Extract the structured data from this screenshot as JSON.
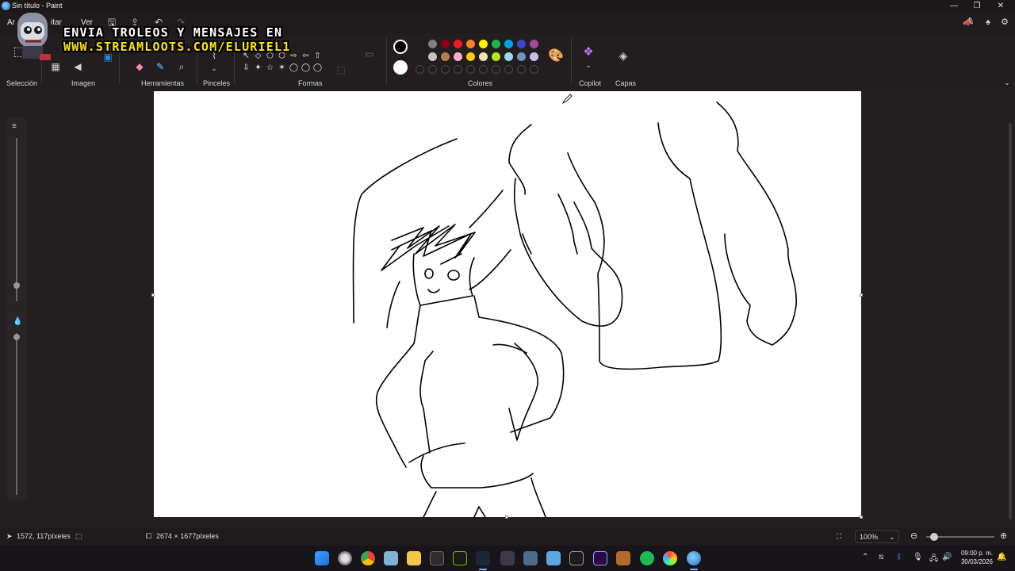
{
  "window": {
    "title": "Sin título - Paint",
    "minimize_glyph": "—",
    "restore_glyph": "❐",
    "close_glyph": "✕"
  },
  "menu": {
    "items": [
      "Archivo",
      "Editar",
      "Ver"
    ],
    "file_partial": "Ar",
    "edit_partial": "itar",
    "view": "Ver"
  },
  "ribbon": {
    "groups": {
      "selection": "Selección",
      "image": "Imagen",
      "tools": "Herramientas",
      "brushes": "Pinceles",
      "shapes": "Formas",
      "colors": "Colores",
      "copilot": "Copilot",
      "layers": "Capas"
    },
    "palette_row1": [
      "#000000",
      "#7f7f7f",
      "#880015",
      "#ed1c24",
      "#ff7f27",
      "#fff200",
      "#22b14c",
      "#00a2e8",
      "#3f48cc",
      "#a349a4"
    ],
    "palette_row2": [
      "#ffffff",
      "#c3c3c3",
      "#b97a57",
      "#ffaec9",
      "#ffc90e",
      "#efe4b0",
      "#b5e61d",
      "#99d9ea",
      "#7092be",
      "#c8bfe7"
    ],
    "primary_color": "#000000",
    "secondary_color": "#ffffff",
    "shapes": [
      "↖",
      "◇",
      "⬠",
      "⬡",
      "⇨",
      "⇦",
      "⇧",
      "⇩",
      "✦",
      "☆",
      "✶",
      "◯",
      "◯"
    ]
  },
  "overlay": {
    "line1": "ENVIA TROLEOS Y MENSAJES EN",
    "line2": "WWW.STREAMLOOTS.COM/ELURIEL1"
  },
  "status": {
    "cursor_position": "1572, 117píxeles",
    "canvas_size": "2674 × 1677píxeles",
    "zoom": "100%"
  },
  "clock": {
    "time": "09:00 p. m.",
    "date": "30/03/2026"
  },
  "taskbar_icons": [
    "windows-start",
    "app-swirl",
    "chrome",
    "notes",
    "files",
    "xbox",
    "nvidia",
    "steam",
    "app-grid",
    "calculator",
    "photos",
    "epic-g",
    "premiere",
    "tiger",
    "spotify",
    "app-circle",
    "paint"
  ]
}
